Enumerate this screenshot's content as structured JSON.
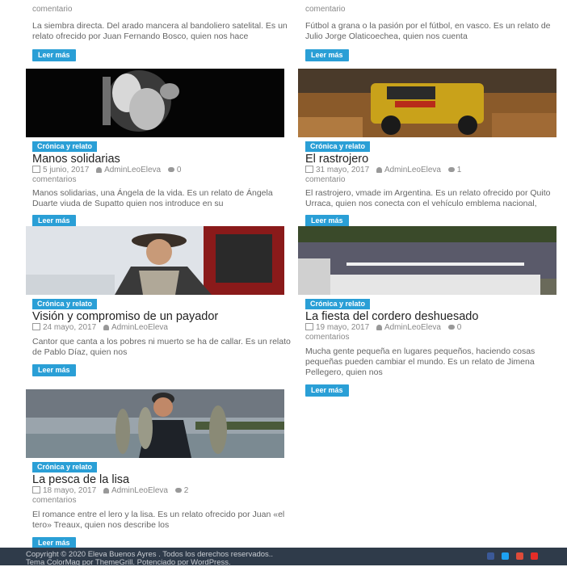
{
  "colors": {
    "accent": "#2a9fd6",
    "footer": "#2f3b4a"
  },
  "read_more": "Leer más",
  "top": {
    "left": {
      "meta_tail": "comentario",
      "excerpt": "La siembra directa. Del arado mancera al bandoliero satelital. Es un relato ofrecido por Juan Fernando Bosco, quien nos hace"
    },
    "right": {
      "meta_tail": "comentario",
      "excerpt": "Fútbol a grana o la pasión por el fútbol, en vasco. Es un relato de Julio Jorge Olaticoechea, quien nos cuenta"
    }
  },
  "posts": [
    {
      "category": "Crónica y relato",
      "title": "Manos solidarias",
      "date": "5 junio, 2017",
      "author": "AdminLeoEleva",
      "comments": "0",
      "comments_word": "comentarios",
      "excerpt": "Manos solidarias, una Ángela de la vida. Es un relato de Ángela Duarte viuda de Supatto quien nos introduce en su"
    },
    {
      "category": "Crónica y relato",
      "title": "El rastrojero",
      "date": "31 mayo, 2017",
      "author": "AdminLeoEleva",
      "comments": "1",
      "comments_word": "comentario",
      "excerpt": "El rastrojero, vmade im Argentina. Es un relato ofrecido por Quito Urraca, quien nos conecta con el vehículo emblema nacional,"
    },
    {
      "category": "Crónica y relato",
      "title": "Visión y compromiso de un payador",
      "date": "24 mayo, 2017",
      "author": "AdminLeoEleva",
      "comments": "",
      "comments_word": "",
      "excerpt": "Cantor que canta a los pobres ni muerto se ha de callar. Es un relato de Pablo Díaz, quien nos"
    },
    {
      "category": "Crónica y relato",
      "title": "La fiesta del cordero deshuesado",
      "date": "19 mayo, 2017",
      "author": "AdminLeoEleva",
      "comments": "0",
      "comments_word": "comentarios",
      "excerpt": "Mucha gente pequeña en lugares pequeños, haciendo cosas pequeñas pueden cambiar el mundo. Es un relato de Jimena Pellegero, quien nos"
    },
    {
      "category": "Crónica y relato",
      "title": "La pesca de la lisa",
      "date": "18 mayo, 2017",
      "author": "AdminLeoEleva",
      "comments": "2",
      "comments_word": "comentarios",
      "excerpt": "El romance entre el lero y la lisa. Es un relato ofrecido por Juan «el tero» Treaux, quien nos describe los"
    }
  ],
  "footer": {
    "line1": "Copyright © 2020 Eleva Buenos Ayres . Todos los derechos reservados..",
    "line2": "Tema ColorMag por ThemeGrill. Potenciado por WordPress."
  }
}
